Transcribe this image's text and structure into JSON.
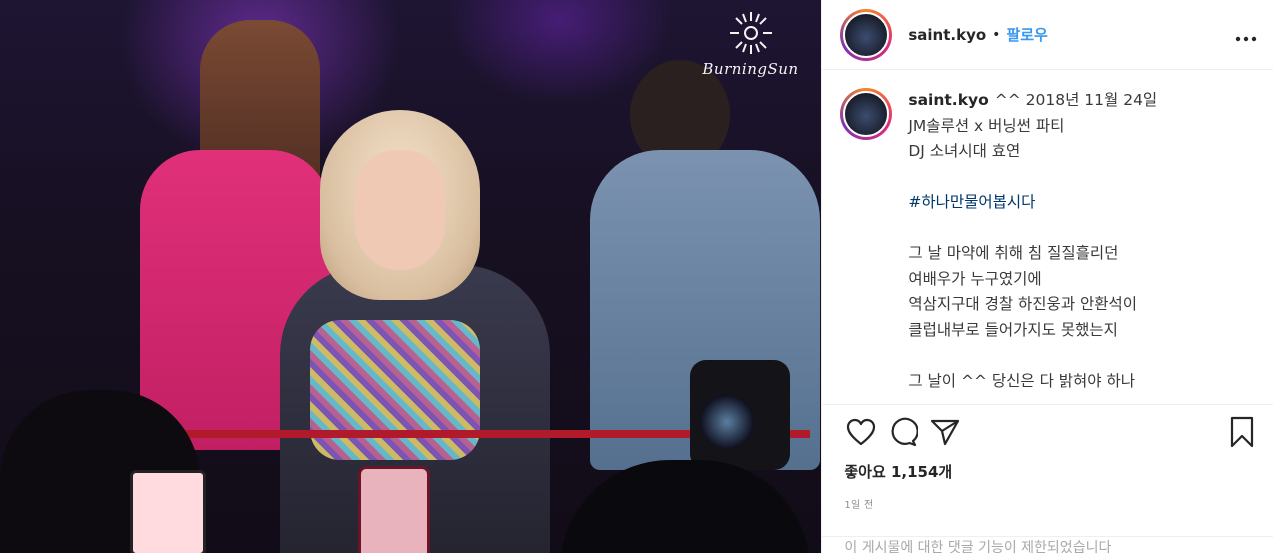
{
  "photo": {
    "watermark": "BurningSun"
  },
  "header": {
    "username": "saint.kyo",
    "separator": "•",
    "follow_label": "팔로우",
    "more_icon": "more-horizontal-icon"
  },
  "caption": {
    "username": "saint.kyo",
    "lines": [
      "^^ 2018년 11월 24일",
      "JM솔루션 x 버닝썬 파티",
      "DJ 소녀시대 효연",
      "",
      "#하나만물어봅시다",
      "",
      "그 날 마약에 취해 침 질질흘리던",
      "여배우가 누구였기에",
      "역삼지구대 경찰 하진웅과 안환석이",
      "클럽내부로 들어가지도 못했는지",
      "",
      "그 날이 ^^ 당신은 다 밝혀야 하나"
    ]
  },
  "actions": {
    "like_icon": "heart-icon",
    "comment_icon": "comment-icon",
    "share_icon": "share-icon",
    "save_icon": "bookmark-icon",
    "likes_text": "좋아요 1,154개",
    "time_text": "1일 전"
  },
  "comment_bar": {
    "text": "이 게시물에 대한 댓글 기능이 제한되었습니다"
  },
  "colors": {
    "link": "#3897f0",
    "hashtag": "#00376b",
    "text": "#262626",
    "muted": "#8e8e8e"
  }
}
